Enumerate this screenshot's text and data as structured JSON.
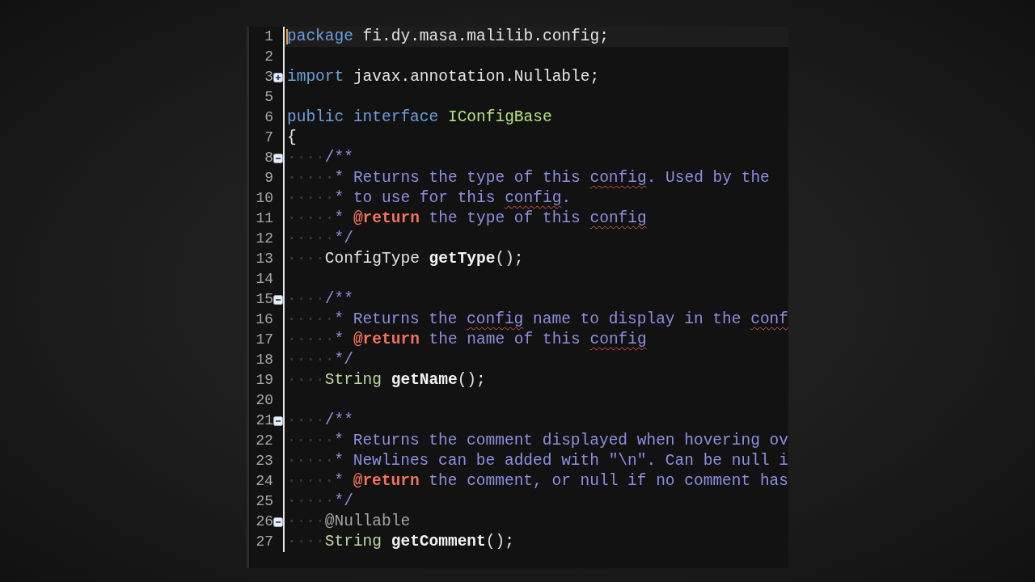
{
  "editor": {
    "lines": [
      {
        "number": "1",
        "current": true,
        "tokens": [
          {
            "kind": "keyword",
            "text": "package",
            "misspelled": false
          },
          {
            "kind": "plain",
            "text": " fi.dy.masa.malilib.config;",
            "misspelled": false
          }
        ]
      },
      {
        "number": "2",
        "current": false
      },
      {
        "number": "3",
        "fold": {
          "collapsed": true
        },
        "current": false,
        "tokens": [
          {
            "kind": "keyword",
            "text": "import",
            "misspelled": false
          },
          {
            "kind": "plain",
            "text": " javax.annotation.Nullable;",
            "misspelled": false
          }
        ]
      },
      {
        "number": "5",
        "current": false
      },
      {
        "number": "6",
        "current": false,
        "tokens": [
          {
            "kind": "keyword",
            "text": "public interface",
            "misspelled": false
          },
          {
            "kind": "class",
            "text": " IConfigBase",
            "misspelled": false
          }
        ]
      },
      {
        "number": "7",
        "current": false,
        "tokens": [
          {
            "kind": "plain",
            "text": "{",
            "misspelled": false
          }
        ]
      },
      {
        "number": "8",
        "fold": {
          "collapsed": false
        },
        "current": false,
        "tokens": [
          {
            "kind": "whitespace",
            "text": "····",
            "misspelled": false
          },
          {
            "kind": "comment",
            "text": "/**",
            "misspelled": false
          }
        ]
      },
      {
        "number": "9",
        "current": false,
        "tokens": [
          {
            "kind": "whitespace",
            "text": "·····",
            "misspelled": false
          },
          {
            "kind": "comment",
            "text": "* Returns the type of this ",
            "misspelled": false
          },
          {
            "kind": "comment",
            "text": "config",
            "misspelled": true
          },
          {
            "kind": "comment",
            "text": ". Used by the",
            "misspelled": false
          }
        ]
      },
      {
        "number": "10",
        "current": false,
        "tokens": [
          {
            "kind": "whitespace",
            "text": "·····",
            "misspelled": false
          },
          {
            "kind": "comment",
            "text": "* to use for this ",
            "misspelled": false
          },
          {
            "kind": "comment",
            "text": "config",
            "misspelled": true
          },
          {
            "kind": "comment",
            "text": ".",
            "misspelled": false
          }
        ]
      },
      {
        "number": "11",
        "current": false,
        "tokens": [
          {
            "kind": "whitespace",
            "text": "·····",
            "misspelled": false
          },
          {
            "kind": "comment",
            "text": "* ",
            "misspelled": false
          },
          {
            "kind": "doc-tag",
            "text": "@return",
            "misspelled": false
          },
          {
            "kind": "comment",
            "text": " the type of this ",
            "misspelled": false
          },
          {
            "kind": "comment",
            "text": "config",
            "misspelled": true
          }
        ]
      },
      {
        "number": "12",
        "current": false,
        "tokens": [
          {
            "kind": "whitespace",
            "text": "·····",
            "misspelled": false
          },
          {
            "kind": "comment",
            "text": "*/",
            "misspelled": false
          }
        ]
      },
      {
        "number": "13",
        "current": false,
        "tokens": [
          {
            "kind": "whitespace",
            "text": "····",
            "misspelled": false
          },
          {
            "kind": "plain",
            "text": "ConfigType ",
            "misspelled": false
          },
          {
            "kind": "method",
            "text": "getType",
            "misspelled": false
          },
          {
            "kind": "plain",
            "text": "();",
            "misspelled": false
          }
        ]
      },
      {
        "number": "14",
        "current": false
      },
      {
        "number": "15",
        "fold": {
          "collapsed": false
        },
        "current": false,
        "tokens": [
          {
            "kind": "whitespace",
            "text": "····",
            "misspelled": false
          },
          {
            "kind": "comment",
            "text": "/**",
            "misspelled": false
          }
        ]
      },
      {
        "number": "16",
        "current": false,
        "tokens": [
          {
            "kind": "whitespace",
            "text": "·····",
            "misspelled": false
          },
          {
            "kind": "comment",
            "text": "* Returns the ",
            "misspelled": false
          },
          {
            "kind": "comment",
            "text": "config",
            "misspelled": true
          },
          {
            "kind": "comment",
            "text": " name to display in the ",
            "misspelled": false
          },
          {
            "kind": "comment",
            "text": "conf",
            "misspelled": true
          }
        ]
      },
      {
        "number": "17",
        "current": false,
        "tokens": [
          {
            "kind": "whitespace",
            "text": "·····",
            "misspelled": false
          },
          {
            "kind": "comment",
            "text": "* ",
            "misspelled": false
          },
          {
            "kind": "doc-tag",
            "text": "@return",
            "misspelled": false
          },
          {
            "kind": "comment",
            "text": " the name of this ",
            "misspelled": false
          },
          {
            "kind": "comment",
            "text": "config",
            "misspelled": true
          }
        ]
      },
      {
        "number": "18",
        "current": false,
        "tokens": [
          {
            "kind": "whitespace",
            "text": "·····",
            "misspelled": false
          },
          {
            "kind": "comment",
            "text": "*/",
            "misspelled": false
          }
        ]
      },
      {
        "number": "19",
        "current": false,
        "tokens": [
          {
            "kind": "whitespace",
            "text": "····",
            "misspelled": false
          },
          {
            "kind": "type",
            "text": "String ",
            "misspelled": false
          },
          {
            "kind": "method",
            "text": "getName",
            "misspelled": false
          },
          {
            "kind": "plain",
            "text": "();",
            "misspelled": false
          }
        ]
      },
      {
        "number": "20",
        "current": false
      },
      {
        "number": "21",
        "fold": {
          "collapsed": false
        },
        "current": false,
        "tokens": [
          {
            "kind": "whitespace",
            "text": "····",
            "misspelled": false
          },
          {
            "kind": "comment",
            "text": "/**",
            "misspelled": false
          }
        ]
      },
      {
        "number": "22",
        "current": false,
        "tokens": [
          {
            "kind": "whitespace",
            "text": "·····",
            "misspelled": false
          },
          {
            "kind": "comment",
            "text": "* Returns the comment displayed when hovering ov",
            "misspelled": false
          }
        ]
      },
      {
        "number": "23",
        "current": false,
        "tokens": [
          {
            "kind": "whitespace",
            "text": "·····",
            "misspelled": false
          },
          {
            "kind": "comment",
            "text": "* Newlines can be added with \"\\n\". Can be null i",
            "misspelled": false
          }
        ]
      },
      {
        "number": "24",
        "current": false,
        "tokens": [
          {
            "kind": "whitespace",
            "text": "·····",
            "misspelled": false
          },
          {
            "kind": "comment",
            "text": "* ",
            "misspelled": false
          },
          {
            "kind": "doc-tag",
            "text": "@return",
            "misspelled": false
          },
          {
            "kind": "comment",
            "text": " the comment, or null if no comment has",
            "misspelled": false
          }
        ]
      },
      {
        "number": "25",
        "current": false,
        "tokens": [
          {
            "kind": "whitespace",
            "text": "·····",
            "misspelled": false
          },
          {
            "kind": "comment",
            "text": "*/",
            "misspelled": false
          }
        ]
      },
      {
        "number": "26",
        "fold": {
          "collapsed": false
        },
        "current": false,
        "tokens": [
          {
            "kind": "whitespace",
            "text": "····",
            "misspelled": false
          },
          {
            "kind": "annotation",
            "text": "@Nullable",
            "misspelled": false
          }
        ]
      },
      {
        "number": "27",
        "current": false,
        "tokens": [
          {
            "kind": "whitespace",
            "text": "····",
            "misspelled": false
          },
          {
            "kind": "type",
            "text": "String ",
            "misspelled": false
          },
          {
            "kind": "method",
            "text": "getComment",
            "misspelled": false
          },
          {
            "kind": "plain",
            "text": "();",
            "misspelled": false
          }
        ]
      }
    ]
  }
}
